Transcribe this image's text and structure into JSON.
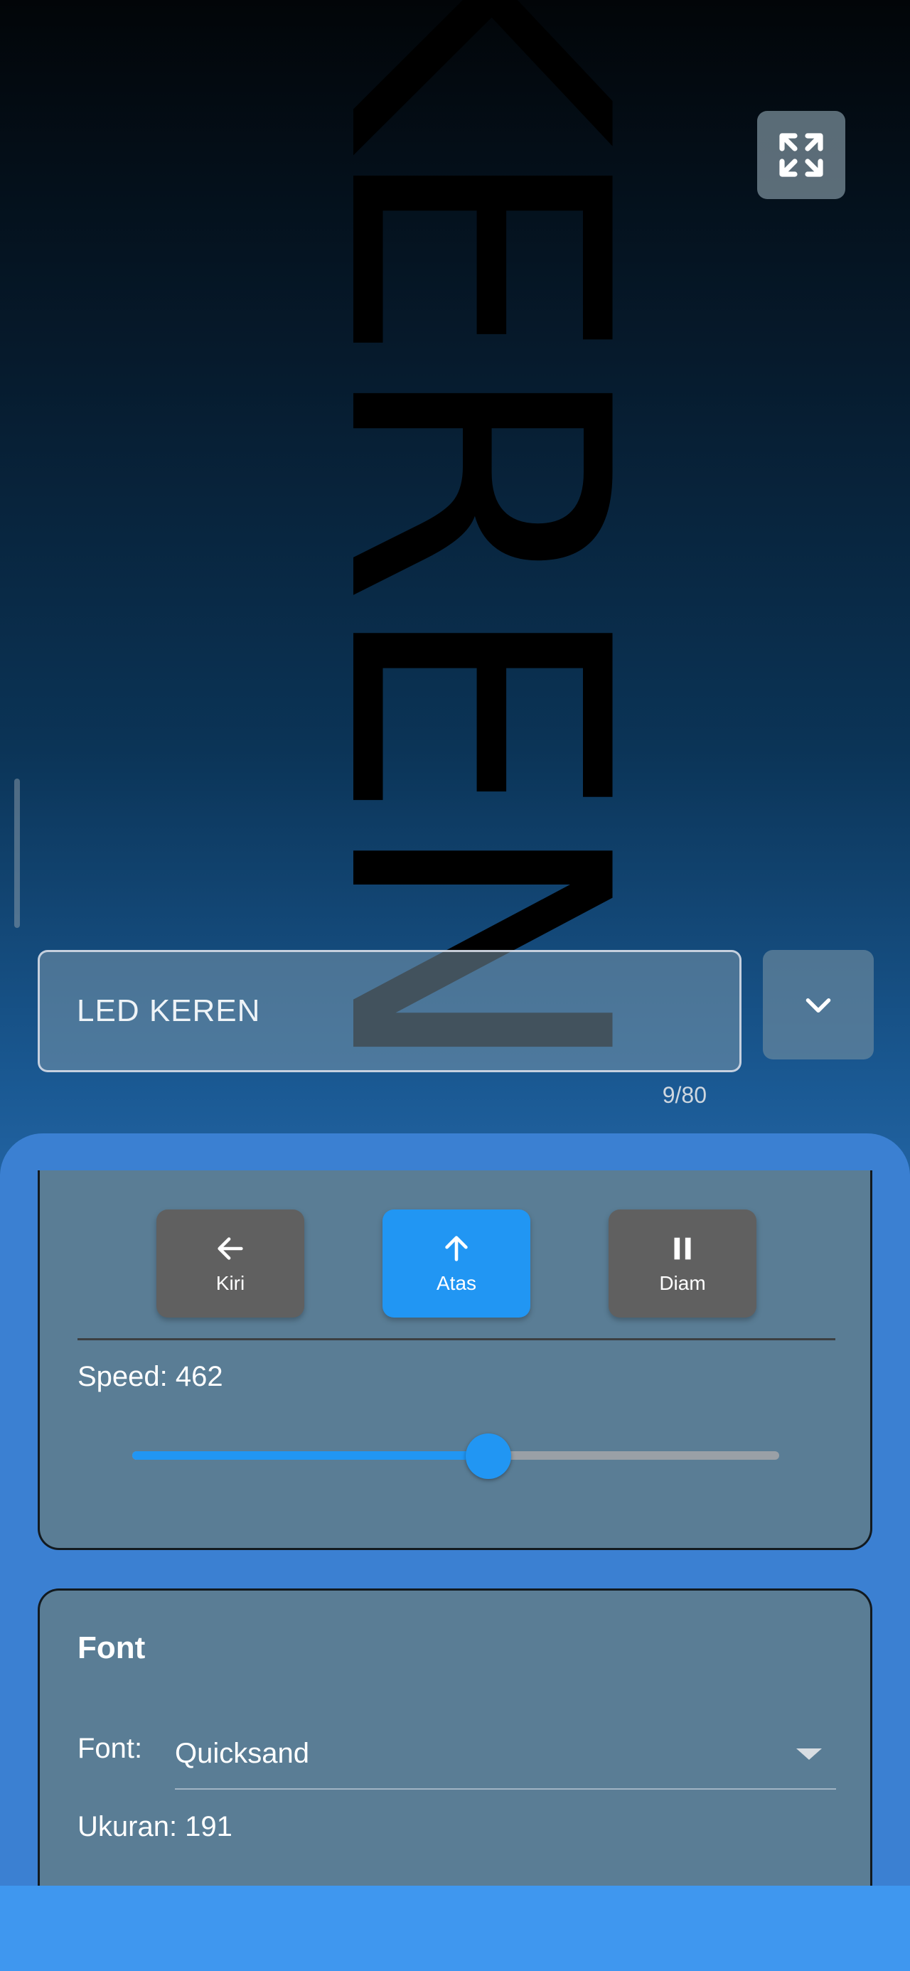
{
  "led": {
    "text": "KEREN"
  },
  "input": {
    "value": "LED KEREN",
    "counter": "9/80"
  },
  "direction": {
    "buttons": [
      {
        "label": "Kiri",
        "icon": "arrow-left-icon",
        "active": false
      },
      {
        "label": "Atas",
        "icon": "arrow-up-icon",
        "active": true
      },
      {
        "label": "Diam",
        "icon": "pause-icon",
        "active": false
      }
    ]
  },
  "speed": {
    "label": "Speed: 462",
    "value_fraction": 0.55
  },
  "font": {
    "title": "Font",
    "label": "Font:",
    "selected": "Quicksand",
    "size_label": "Ukuran: 191"
  },
  "colors": {
    "accent": "#2196f3",
    "inactive_button": "#606060",
    "card": "#5a7d95",
    "panel": "#3b80d2"
  }
}
